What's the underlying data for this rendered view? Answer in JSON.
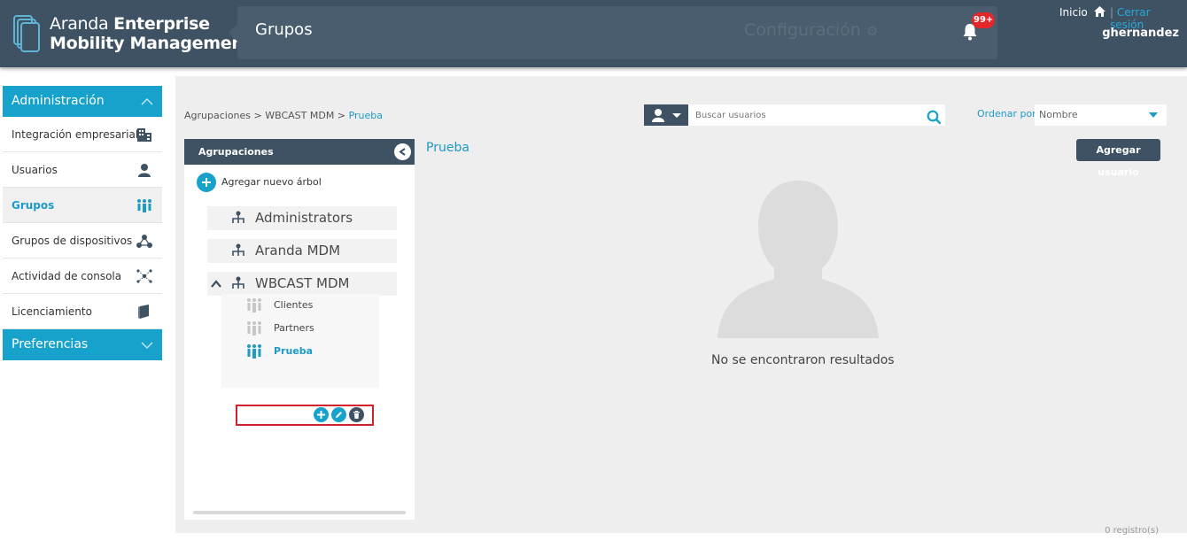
{
  "header": {
    "brand_light": "Aranda ",
    "brand_bold_1": "Enterprise",
    "brand_bold_2": "Mobility Management",
    "page_title": "Grupos",
    "config_label": "Configuración",
    "notification_badge": "99+",
    "inicio": "Inicio",
    "separator": "|",
    "cerrar_sesion": "Cerrar sesión",
    "username": "ghernandez"
  },
  "sidebar": {
    "admin_section": "Administración",
    "items": [
      {
        "label": "Integración empresarial",
        "icon": "building-icon"
      },
      {
        "label": "Usuarios",
        "icon": "user-icon"
      },
      {
        "label": "Grupos",
        "icon": "group-icon",
        "active": true
      },
      {
        "label": "Grupos de dispositivos",
        "icon": "network-icon"
      },
      {
        "label": "Actividad de consola",
        "icon": "nodes-icon"
      },
      {
        "label": "Licenciamiento",
        "icon": "book-icon"
      }
    ],
    "pref_section": "Preferencias"
  },
  "breadcrumb": {
    "part1": "Agrupaciones",
    "sep": " > ",
    "part2": "WBCAST MDM",
    "current": "Prueba"
  },
  "search": {
    "placeholder": "Buscar usuarios",
    "order_label": "Ordenar por:",
    "order_value": "Nombre"
  },
  "tree": {
    "header": "Agrupaciones",
    "add_tree_label": "Agregar nuevo árbol",
    "nodes": [
      "Administrators",
      "Aranda MDM",
      "WBCAST MDM"
    ],
    "children": [
      "Clientes",
      "Partners",
      "Prueba"
    ]
  },
  "content": {
    "title": "Prueba",
    "add_user_label": "Agregar usuario",
    "no_results": "No se encontraron resultados",
    "records": "0 registro(s)"
  },
  "colors": {
    "header_bg": "#3e5264",
    "accent": "#17a2cc",
    "badge": "#e3262a",
    "selection_border": "#d1222a"
  }
}
